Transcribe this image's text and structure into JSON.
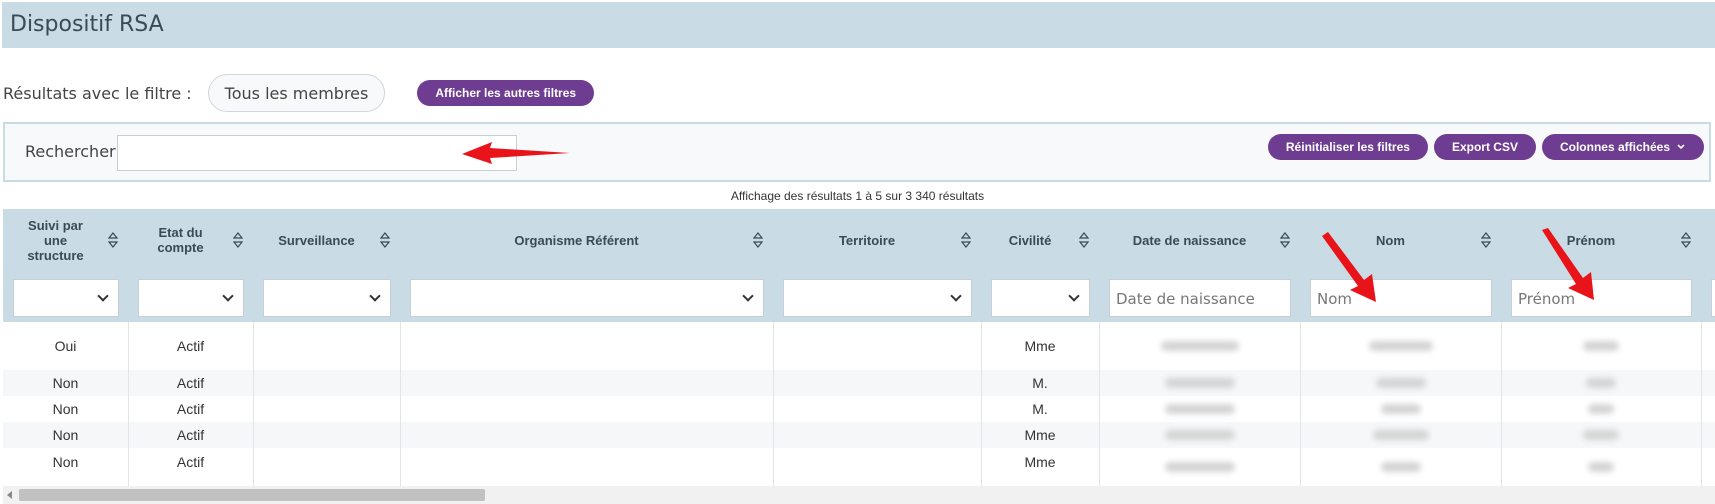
{
  "page": {
    "title": "Dispositif RSA",
    "filter_label": "Résultats avec le filtre :",
    "filter_pill": "Tous les membres",
    "more_filters_button": "Afficher les autres filtres"
  },
  "search": {
    "label": "Rechercher",
    "value": "",
    "buttons": {
      "reset": "Réinitialiser les filtres",
      "export": "Export CSV",
      "columns": "Colonnes affichées"
    }
  },
  "results_text": "Affichage des résultats 1 à 5 sur 3 340 résultats",
  "columns": [
    {
      "label": "Suivi par une structure",
      "filter_type": "select",
      "placeholder": ""
    },
    {
      "label": "Etat du compte",
      "filter_type": "select",
      "placeholder": ""
    },
    {
      "label": "Surveillance",
      "filter_type": "select",
      "placeholder": ""
    },
    {
      "label": "Organisme Référent",
      "filter_type": "select",
      "placeholder": ""
    },
    {
      "label": "Territoire",
      "filter_type": "select",
      "placeholder": ""
    },
    {
      "label": "Civilité",
      "filter_type": "select",
      "placeholder": ""
    },
    {
      "label": "Date de naissance",
      "filter_type": "text",
      "placeholder": "Date de naissance"
    },
    {
      "label": "Nom",
      "filter_type": "text",
      "placeholder": "Nom"
    },
    {
      "label": "Prénom",
      "filter_type": "text",
      "placeholder": "Prénom"
    }
  ],
  "rows": [
    [
      "Oui",
      "Actif",
      "",
      "",
      "",
      "Mme"
    ],
    [
      "Non",
      "Actif",
      "",
      "",
      "",
      "M."
    ],
    [
      "Non",
      "Actif",
      "",
      "",
      "",
      "M."
    ],
    [
      "Non",
      "Actif",
      "",
      "",
      "",
      "Mme"
    ],
    [
      "Non",
      "Actif",
      "",
      "",
      "",
      "Mme"
    ]
  ],
  "colors": {
    "header_bg": "#c9dbe4",
    "accent_purple": "#6e3d91",
    "annotation_red": "#e8141a"
  },
  "icons": {
    "sort": "sort-both-icon",
    "select": "chevron-down-icon",
    "annotation": "red-arrow-icon"
  }
}
